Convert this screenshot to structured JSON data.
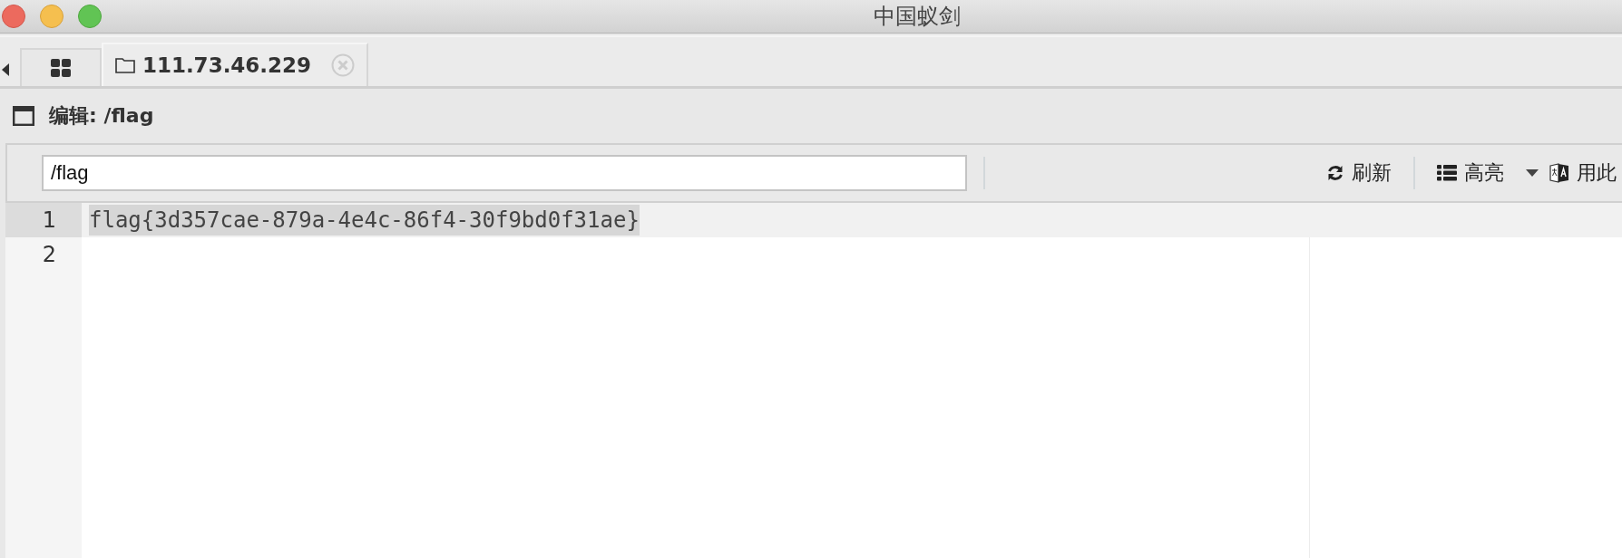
{
  "window": {
    "title": "中国蚁剑"
  },
  "tabs": [
    {
      "kind": "grid",
      "selected": false
    },
    {
      "kind": "host",
      "label": "111.73.46.229",
      "selected": true
    }
  ],
  "panel": {
    "title": "编辑: /flag"
  },
  "toolbar": {
    "path": "/flag",
    "buttons": [
      {
        "kind": "refresh",
        "label": "刷新"
      },
      {
        "kind": "highlight",
        "label": "高亮"
      },
      {
        "kind": "encoding",
        "label": "用此"
      }
    ]
  },
  "editor": {
    "lines": [
      {
        "number": "1",
        "text": "flag{3d357cae-879a-4e4c-86f4-30f9bd0f31ae}",
        "selected": true
      },
      {
        "number": "2",
        "selected": false
      }
    ]
  }
}
